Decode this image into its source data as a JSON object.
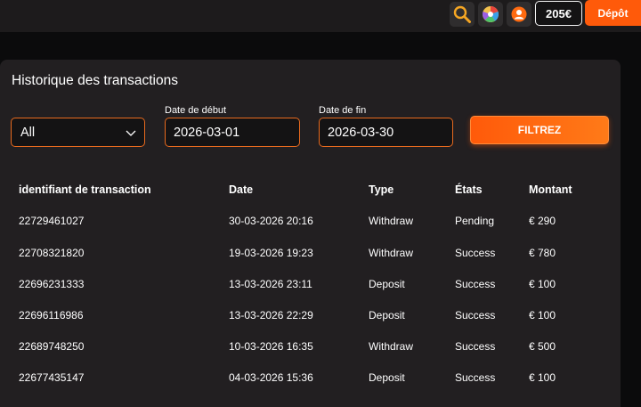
{
  "header": {
    "balance": "205€",
    "depot_label": "Dépôt"
  },
  "panel": {
    "title": "Historique des transactions"
  },
  "filters": {
    "status_value": "All",
    "start_label": "Date de début",
    "start_value": "2026-03-01",
    "end_label": "Date de fin",
    "end_value": "2026-03-30",
    "filter_label": "FILTREZ"
  },
  "table": {
    "columns": [
      "identifiant de transaction",
      "Date",
      "Type",
      "États",
      "Montant"
    ],
    "rows": [
      [
        "22729461027",
        "30-03-2026 20:16",
        "Withdraw",
        "Pending",
        "€ 290"
      ],
      [
        "22708321820",
        "19-03-2026 19:23",
        "Withdraw",
        "Success",
        "€ 780"
      ],
      [
        "22696231333",
        "13-03-2026 23:11",
        "Deposit",
        "Success",
        "€ 100"
      ],
      [
        "22696116986",
        "13-03-2026 22:29",
        "Deposit",
        "Success",
        "€ 100"
      ],
      [
        "22689748250",
        "10-03-2026 16:35",
        "Withdraw",
        "Success",
        "€ 500"
      ],
      [
        "22677435147",
        "04-03-2026 15:36",
        "Deposit",
        "Success",
        "€ 100"
      ]
    ]
  },
  "icons": [
    "search-icon",
    "wheel-icon",
    "user-icon",
    "chevron-down-icon"
  ],
  "colors": {
    "accent": "#ff5a0a",
    "panel": "#221f21",
    "background": "#0b0b0c"
  }
}
